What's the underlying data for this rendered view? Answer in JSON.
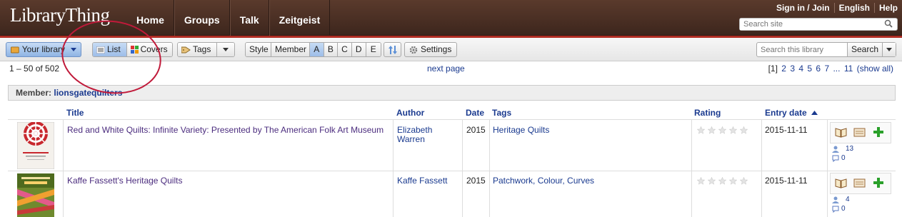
{
  "header": {
    "logo": "LibraryThing",
    "nav": [
      "Home",
      "Groups",
      "Talk",
      "Zeitgeist"
    ],
    "top_links": [
      "Sign in / Join",
      "English",
      "Help"
    ],
    "site_search_placeholder": "Search site"
  },
  "toolbar": {
    "your_library": "Your library",
    "list": "List",
    "covers": "Covers",
    "tags": "Tags",
    "style": "Style",
    "member": "Member",
    "styles": [
      "A",
      "B",
      "C",
      "D",
      "E"
    ],
    "active_style": "A",
    "settings": "Settings",
    "search_placeholder": "Search this library",
    "search_button": "Search"
  },
  "paging": {
    "count": "1 – 50 of 502",
    "next": "next page",
    "current": "[1]",
    "pages": [
      "2",
      "3",
      "4",
      "5",
      "6",
      "7",
      "...",
      "11",
      "(show all)"
    ]
  },
  "member_bar": {
    "label": "Member:",
    "name": "lionsgatequilters"
  },
  "table": {
    "columns": {
      "title": "Title",
      "author": "Author",
      "date": "Date",
      "tags": "Tags",
      "rating": "Rating",
      "entry_date": "Entry date"
    },
    "rows": [
      {
        "title": "Red and White Quilts: Infinite Variety: Presented by The American Folk Art Museum",
        "author": "Elizabeth Warren",
        "date": "2015",
        "tags": "Heritage Quilts",
        "rating": 0,
        "entry_date": "2015-11-11",
        "members": "13",
        "reviews": "0"
      },
      {
        "title": "Kaffe Fassett's Heritage Quilts",
        "author": "Kaffe Fassett",
        "date": "2015",
        "tags": "Patchwork, Colour, Curves",
        "rating": 0,
        "entry_date": "2015-11-11",
        "members": "4",
        "reviews": "0"
      }
    ]
  },
  "colors": {
    "header_bg": "#4a2f24",
    "accent_red": "#b02d23",
    "link_blue": "#1a3a8f",
    "annotation": "#c01a3a"
  }
}
